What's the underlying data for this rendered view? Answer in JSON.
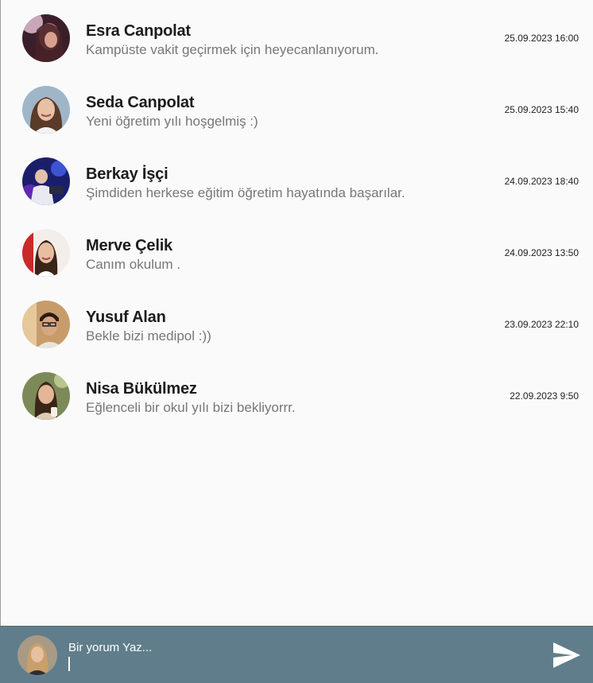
{
  "comments": [
    {
      "name": "Esra Canpolat",
      "text": "Kampüste vakit geçirmek için heyecanlanıyorum.",
      "time": "25.09.2023 16:00"
    },
    {
      "name": "Seda Canpolat",
      "text": "Yeni öğretim yılı hoşgelmiş :)",
      "time": "25.09.2023 15:40"
    },
    {
      "name": "Berkay İşçi",
      "text": "Şimdiden herkese eğitim öğretim hayatında başarılar.",
      "time": "24.09.2023 18:40"
    },
    {
      "name": "Merve Çelik",
      "text": "Canım okulum .",
      "time": "24.09.2023 13:50"
    },
    {
      "name": "Yusuf Alan",
      "text": "Bekle bizi medipol :))",
      "time": "23.09.2023 22:10"
    },
    {
      "name": "Nisa Bükülmez",
      "text": "Eğlenceli bir okul yılı bizi bekliyorrr.",
      "time": "22.09.2023 9:50"
    }
  ],
  "composer": {
    "placeholder": "Bir yorum Yaz...",
    "value": "",
    "send_icon": "send-icon",
    "background": "#607d8b"
  },
  "colors": {
    "background": "#fafafa",
    "name": "#1c1c1c",
    "comment_text": "#777777",
    "timestamp": "#222222"
  }
}
